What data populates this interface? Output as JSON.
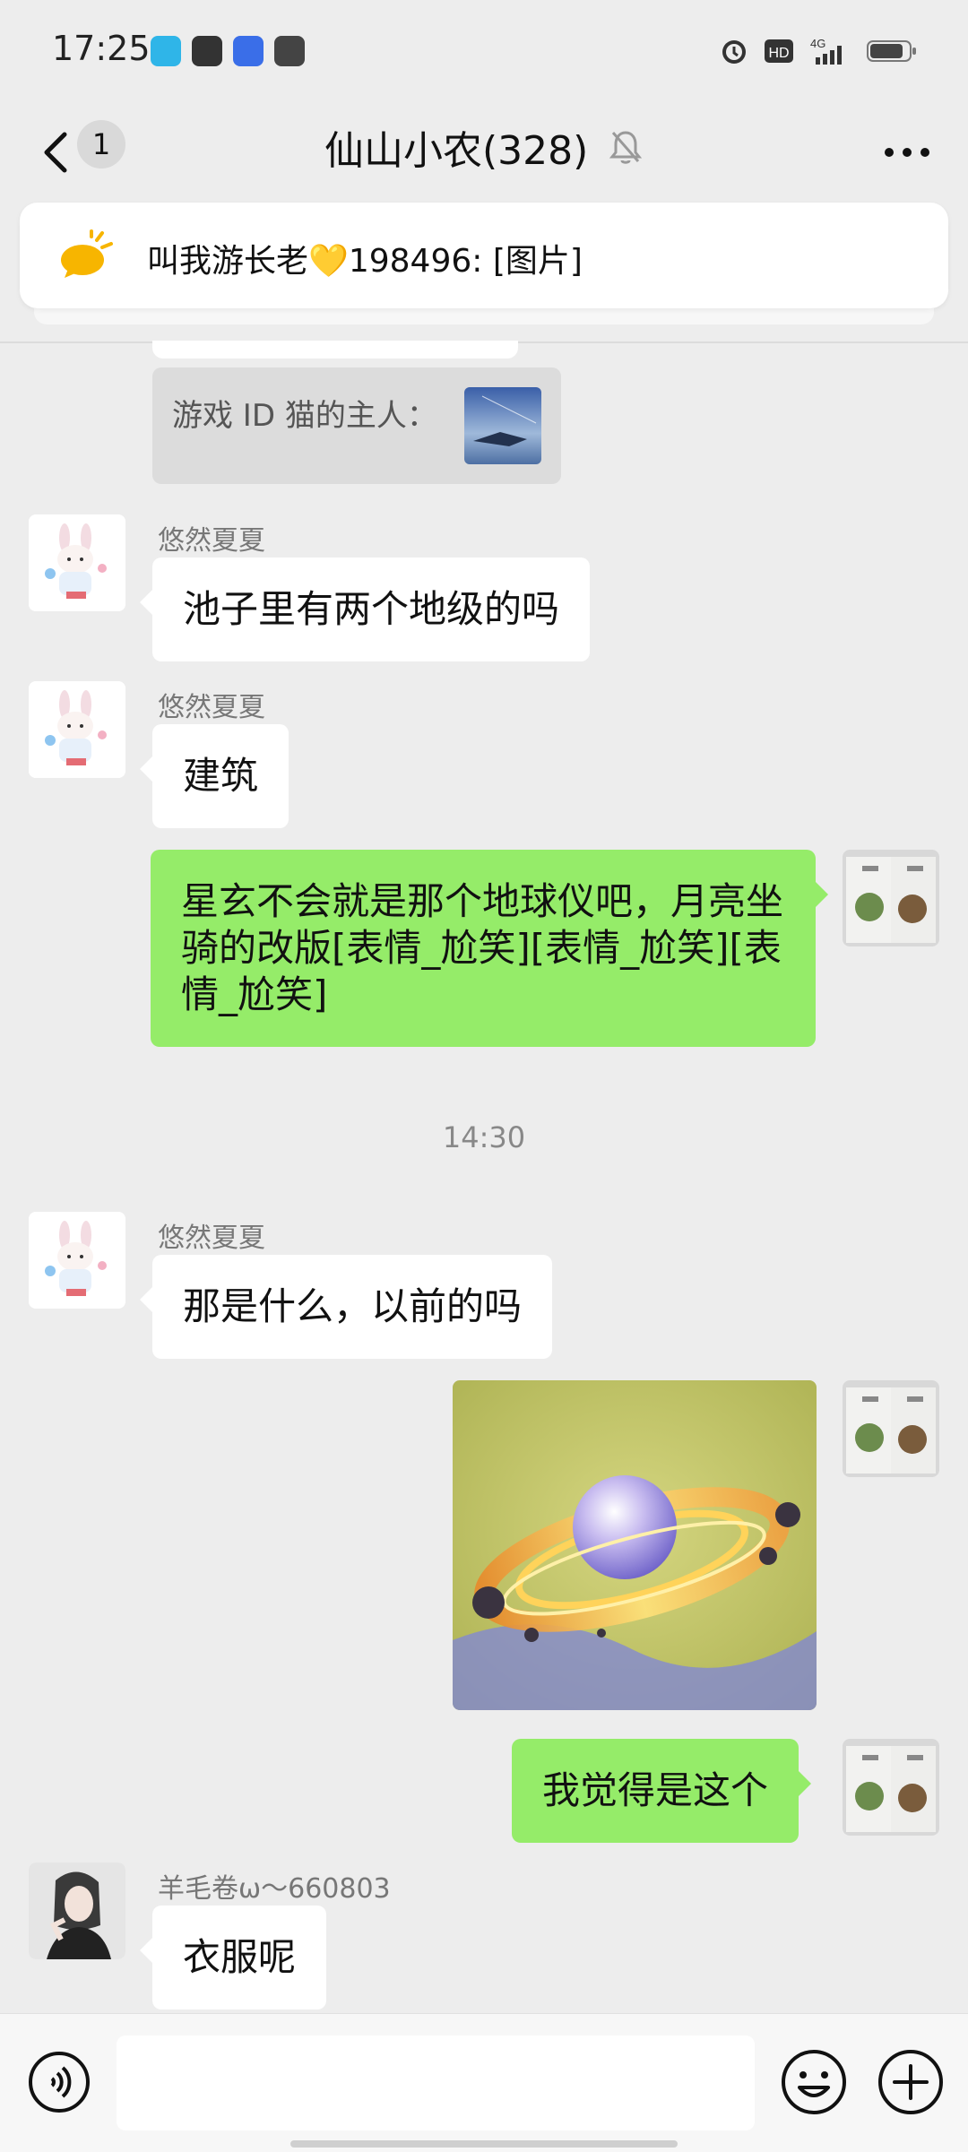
{
  "status_bar": {
    "time": "17:25",
    "network": "4G"
  },
  "header": {
    "unread_count": "1",
    "title": "仙山小农(328)"
  },
  "pinned": {
    "text": "叫我游长老💛198496: [图片]"
  },
  "quote": {
    "text": "游戏 ID 猫的主人："
  },
  "messages": [
    {
      "sender": "悠然夏夏",
      "text": "池子里有两个地级的吗"
    },
    {
      "sender": "悠然夏夏",
      "text": "建筑"
    },
    {
      "text": "星玄不会就是那个地球仪吧，月亮坐骑的改版[表情_尬笑][表情_尬笑][表情_尬笑]"
    },
    {
      "sender": "悠然夏夏",
      "text": "那是什么，以前的吗"
    },
    {
      "text": "我觉得是这个"
    },
    {
      "sender": "羊毛卷ω～660803",
      "text": "衣服呢"
    }
  ],
  "timestamp": "14:30",
  "colors": {
    "outgoing_bubble": "#95EC69",
    "background": "#EDEDED"
  },
  "icons": [
    "back-icon",
    "mute-bell-icon",
    "more-icon",
    "voice-icon",
    "emoji-icon",
    "plus-icon"
  ]
}
